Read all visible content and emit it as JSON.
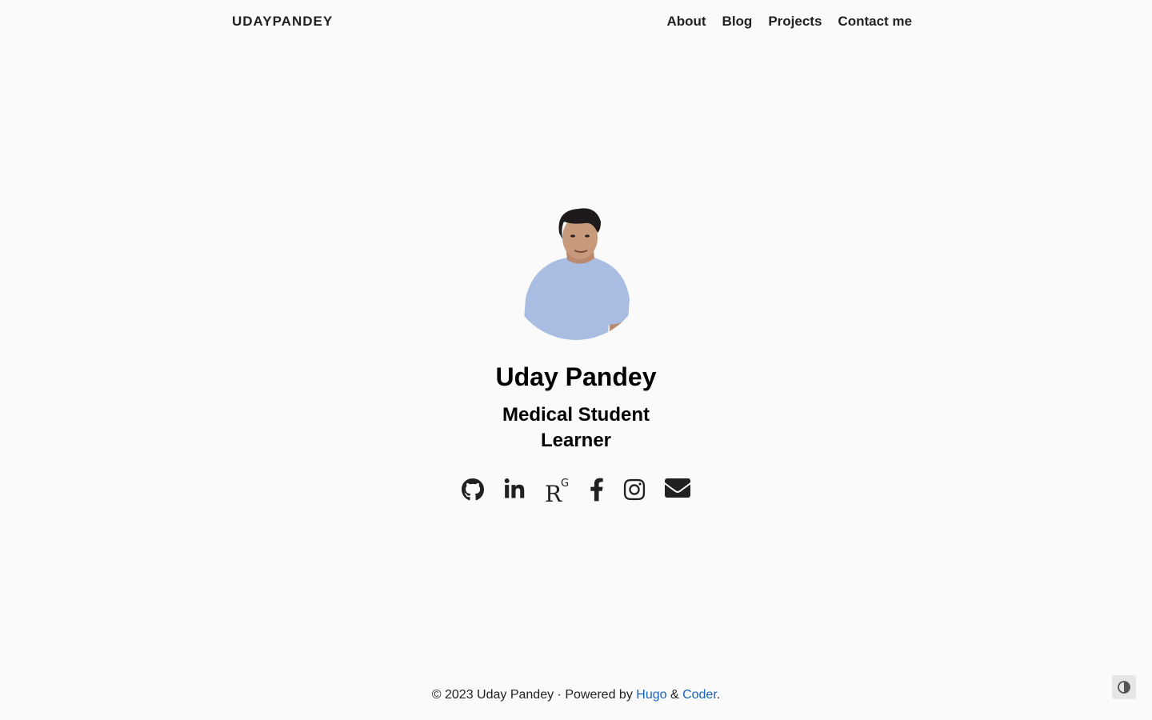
{
  "header": {
    "brand": "UDAYPANDEY",
    "nav": [
      {
        "label": "About"
      },
      {
        "label": "Blog"
      },
      {
        "label": "Projects"
      },
      {
        "label": "Contact me"
      }
    ]
  },
  "hero": {
    "name": "Uday Pandey",
    "tagline_lines": [
      "Medical Student",
      "Learner"
    ],
    "social_icons": [
      "github-icon",
      "linkedin-icon",
      "researchgate-icon",
      "facebook-icon",
      "instagram-icon",
      "email-icon"
    ]
  },
  "footer": {
    "copyright": "© 2023 Uday Pandey · Powered by ",
    "link_hugo": "Hugo",
    "separator": " & ",
    "link_coder": "Coder",
    "end": "."
  },
  "colors": {
    "background": "#fafafa",
    "text": "#212121",
    "link": "#1565c0",
    "shirt": "#a9bde3"
  }
}
